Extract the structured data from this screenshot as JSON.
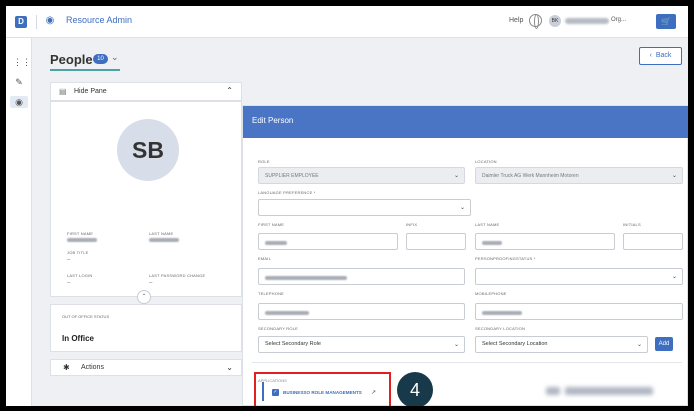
{
  "topbar": {
    "logo_glyph": "D",
    "app_title": "Resource Admin",
    "help": "Help",
    "user_initials": "BK",
    "user_org": "Org..."
  },
  "page": {
    "title": "People",
    "count": "10",
    "back_label": "Back"
  },
  "left_panel": {
    "hide_pane_label": "Hide Pane",
    "avatar_initials": "SB",
    "fields": {
      "first_name_label": "FIRST NAME",
      "last_name_label": "LAST NAME",
      "job_title_label": "JOB TITLE",
      "job_title_value": "–",
      "last_login_label": "LAST LOGIN",
      "last_login_value": "–",
      "last_pw_change_label": "LAST PASSWORD CHANGE",
      "last_pw_change_value": "–"
    },
    "out_of_office_label": "OUT OF OFFICE STATUS",
    "out_of_office_value": "In Office",
    "actions_label": "Actions"
  },
  "edit": {
    "title": "Edit Person",
    "role_label": "ROLE",
    "role_value": "SUPPLIER EMPLOYEE",
    "location_label": "LOCATION",
    "location_value": "Daimler Truck AG Werk Mannheim Motoren",
    "language_label": "LANGUAGE PREFERENCE *",
    "first_name_label": "FIRST NAME",
    "infix_label": "INFIX",
    "last_name_label": "LAST NAME",
    "initials_label": "INITIALS",
    "email_label": "EMAIL",
    "person_proofing_label": "PERSONPROOFINGSTATUS *",
    "telephone_label": "TELEPHONE",
    "mobilephone_label": "MOBILEPHONE",
    "secondary_role_label": "SECONDARY ROLE",
    "secondary_role_placeholder": "Select Secondary Role",
    "secondary_location_label": "SECONDARY LOCATION",
    "secondary_location_placeholder": "Select Secondary Location",
    "add_label": "Add",
    "applications_label": "APPLICATIONS",
    "application_name": "BUSINESSO ROLE MANAGEMENTS",
    "step_number": "4"
  }
}
